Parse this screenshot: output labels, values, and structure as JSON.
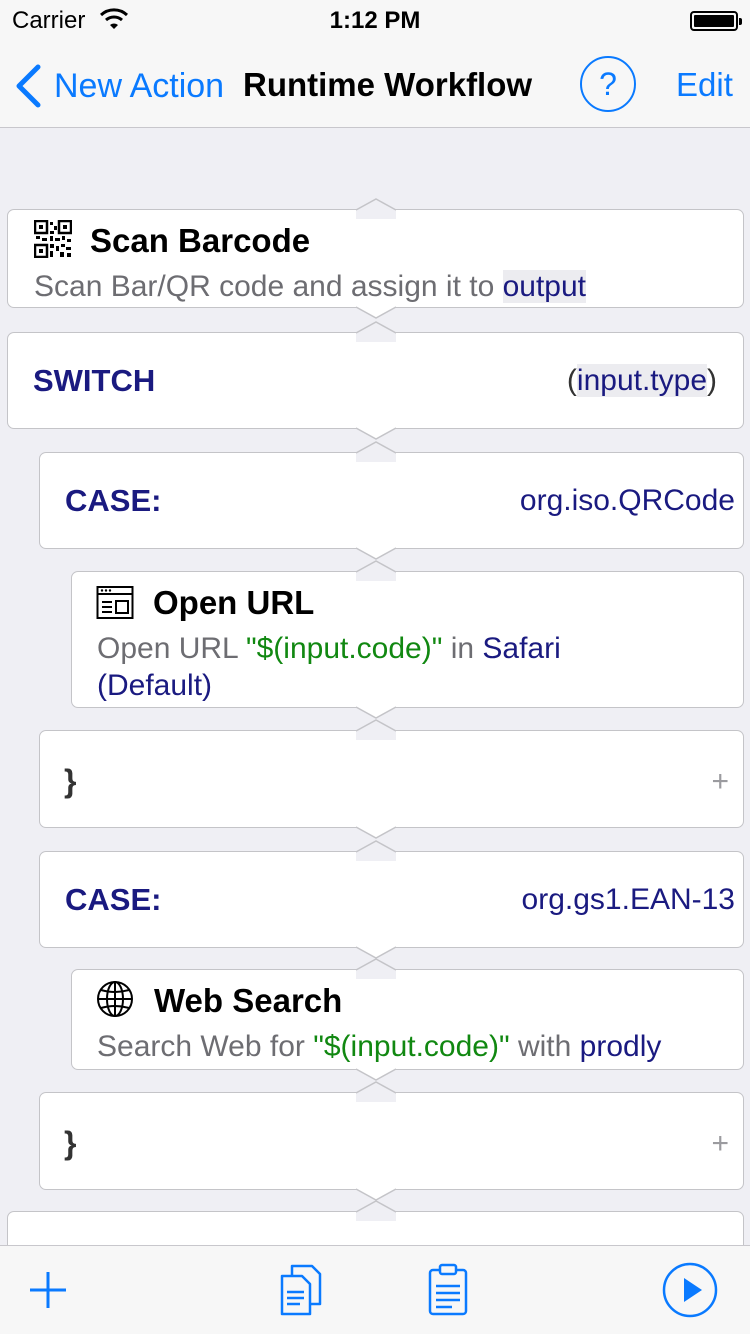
{
  "status_bar": {
    "carrier": "Carrier",
    "time": "1:12 PM"
  },
  "nav": {
    "back_label": "New Action",
    "title": "Runtime Workflow",
    "help_label": "?",
    "edit_label": "Edit"
  },
  "workflow": {
    "scan_barcode": {
      "icon": "qr-code-icon",
      "title": "Scan Barcode",
      "desc_prefix": "Scan Bar/QR code and assign it to ",
      "desc_token": "output"
    },
    "switch": {
      "keyword": "SWITCH",
      "open_paren": "(",
      "expression": "input.type",
      "close_paren": ")"
    },
    "case1": {
      "keyword": "CASE:",
      "value": "org.iso.QRCode"
    },
    "open_url": {
      "icon": "browser-window-icon",
      "title": "Open URL",
      "desc_prefix": "Open URL ",
      "desc_string": "\"$(input.code)\"",
      "desc_mid": " in ",
      "desc_token_1": "Safari",
      "desc_token_2": "(Default)"
    },
    "case1_end": {
      "brace": "}",
      "plus": "+"
    },
    "case2": {
      "keyword": "CASE:",
      "value": "org.gs1.EAN-13"
    },
    "web_search": {
      "icon": "globe-icon",
      "title": "Web Search",
      "desc_prefix": "Search Web for ",
      "desc_string": "\"$(input.code)\"",
      "desc_mid": " with ",
      "desc_token": "prodly"
    },
    "case2_end": {
      "brace": "}",
      "plus": "+"
    }
  },
  "toolbar": {
    "items": [
      "add-icon",
      "copy-icon",
      "paste-icon",
      "play-icon"
    ]
  },
  "colors": {
    "accent": "#0a7aff",
    "keyword": "#1a1a80",
    "string": "#118811",
    "secondary_text": "#6d6d72",
    "background": "#efeff4"
  }
}
